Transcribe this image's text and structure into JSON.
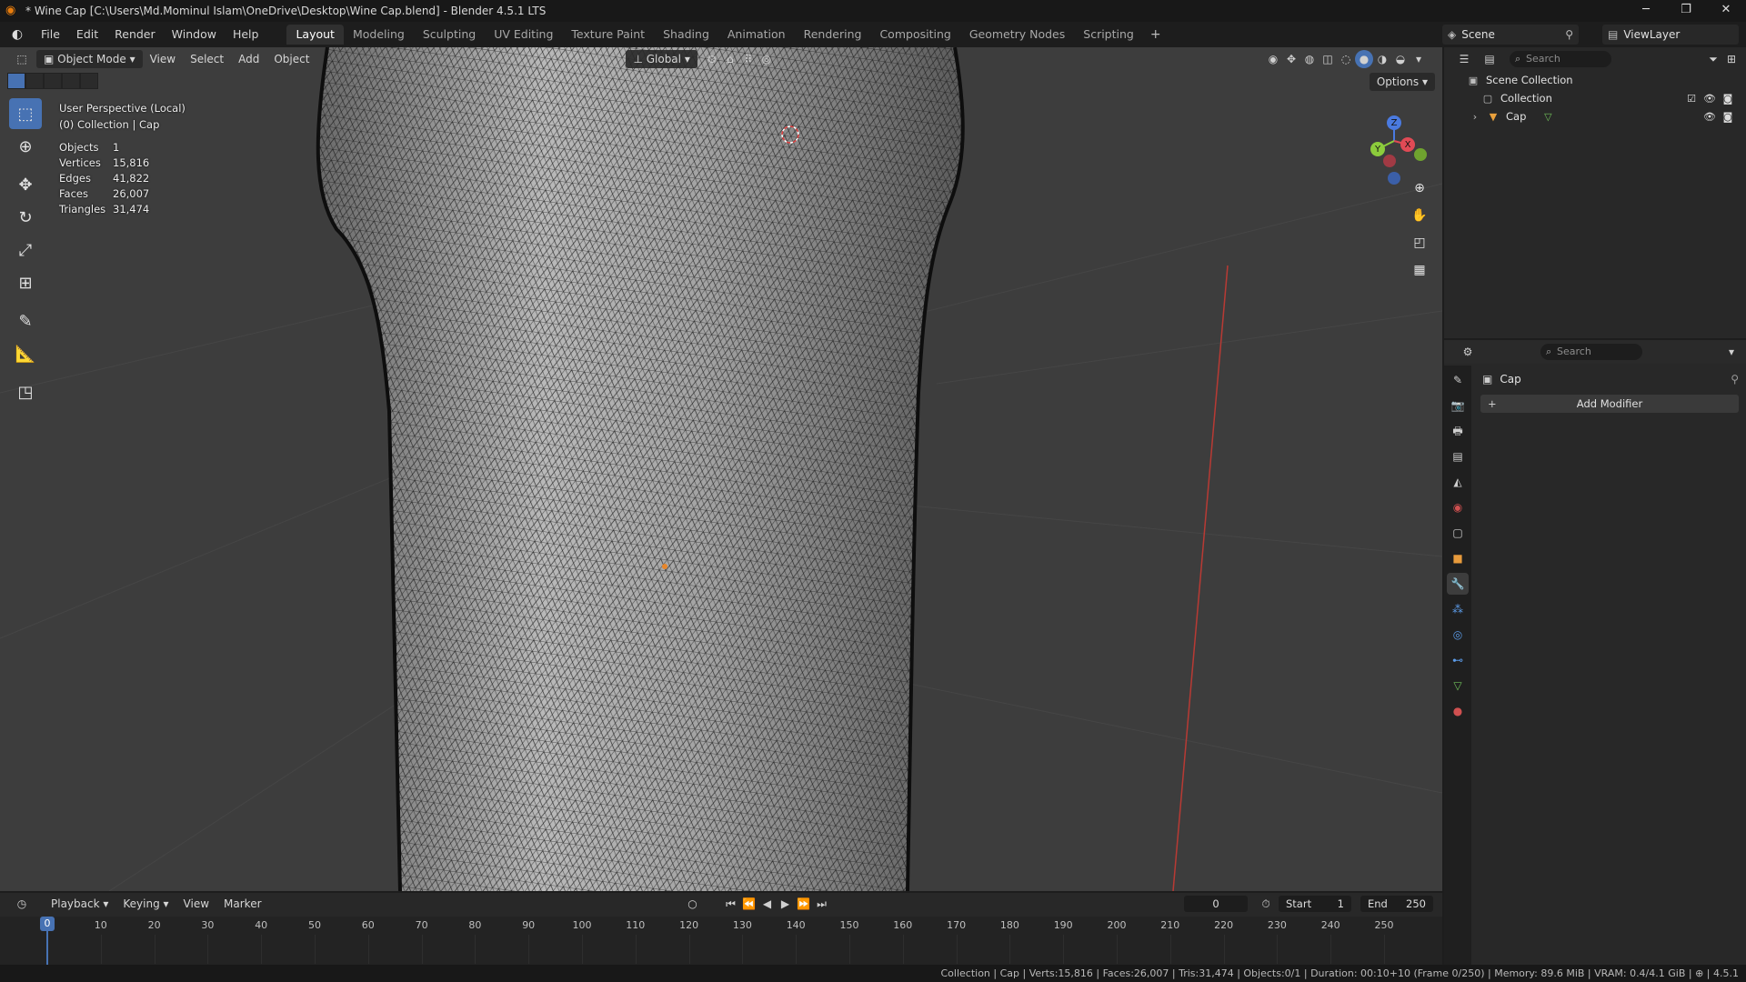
{
  "window": {
    "title": "* Wine Cap [C:\\Users\\Md.Mominul Islam\\OneDrive\\Desktop\\Wine Cap.blend] - Blender 4.5.1 LTS",
    "controls": [
      "─",
      "❐",
      "✕"
    ]
  },
  "menu": {
    "items": [
      "File",
      "Edit",
      "Render",
      "Window",
      "Help"
    ]
  },
  "workspaces": {
    "tabs": [
      "Layout",
      "Modeling",
      "Sculpting",
      "UV Editing",
      "Texture Paint",
      "Shading",
      "Animation",
      "Rendering",
      "Compositing",
      "Geometry Nodes",
      "Scripting"
    ],
    "active": "Layout",
    "add_label": "+"
  },
  "scene": {
    "name": "Scene",
    "view_layer": "ViewLayer"
  },
  "viewport": {
    "mode": "Object Mode",
    "menus": [
      "View",
      "Select",
      "Add",
      "Object"
    ],
    "transform_orientation": "Global",
    "options_label": "Options",
    "view_name": "User Perspective (Local)",
    "collection_info": "(0) Collection | Cap",
    "stats": [
      {
        "label": "Objects",
        "value": "1"
      },
      {
        "label": "Vertices",
        "value": "15,816"
      },
      {
        "label": "Edges",
        "value": "41,822"
      },
      {
        "label": "Faces",
        "value": "26,007"
      },
      {
        "label": "Triangles",
        "value": "31,474"
      }
    ],
    "gizmo_axes": [
      "Z",
      "Y",
      "X"
    ],
    "colors": {
      "background": "#3d3d3d",
      "mesh": "#a9a9a9",
      "wire": "#141414",
      "x_axis": "#c0392b",
      "accent": "#4772b3"
    }
  },
  "outliner": {
    "search_placeholder": "Search",
    "root": "Scene Collection",
    "items": [
      {
        "name": "Collection",
        "icon": "collection-icon"
      },
      {
        "name": "Cap",
        "icon": "mesh-object-icon"
      }
    ]
  },
  "properties": {
    "search_placeholder": "Search",
    "object_name": "Cap",
    "add_modifier_label": "Add Modifier",
    "active_tab": "modifier"
  },
  "timeline": {
    "menus": [
      "Playback",
      "Keying",
      "View",
      "Marker"
    ],
    "current_frame": "0",
    "start_label": "Start",
    "start": "1",
    "end_label": "End",
    "end": "250",
    "ticks": [
      "10",
      "20",
      "30",
      "40",
      "50",
      "60",
      "70",
      "80",
      "90",
      "100",
      "110",
      "120",
      "130",
      "140",
      "150",
      "160",
      "170",
      "180",
      "190",
      "200",
      "210",
      "220",
      "230",
      "240",
      "250"
    ],
    "playhead_label": "0"
  },
  "statusbar": {
    "text": "Collection | Cap | Verts:15,816 | Faces:26,007 | Tris:31,474 | Objects:0/1 | Duration: 00:10+10 (Frame 0/250) | Memory: 89.6 MiB | VRAM: 0.4/4.1 GiB | ⊕ | 4.5.1"
  }
}
